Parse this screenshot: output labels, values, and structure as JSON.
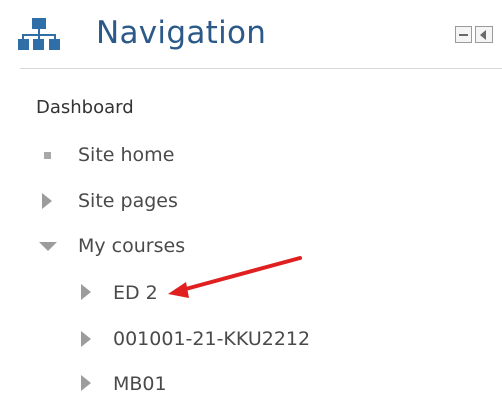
{
  "header": {
    "title": "Navigation",
    "icon": "sitemap-icon",
    "controls": [
      "minimize-icon",
      "dock-icon"
    ]
  },
  "tree": {
    "root": "Dashboard",
    "site_home": "Site home",
    "site_pages": "Site pages",
    "my_courses": "My courses",
    "courses": [
      {
        "label": "ED 2"
      },
      {
        "label": "001001-21-KKU2212"
      },
      {
        "label": "MB01"
      }
    ]
  },
  "annotation": {
    "type": "red-arrow",
    "target": "ED 2",
    "color": "#e02020"
  },
  "colors": {
    "title": "#2b5a8a",
    "icon": "#2f6ea6",
    "text": "#4a4a4a",
    "arrow": "#e02020"
  }
}
